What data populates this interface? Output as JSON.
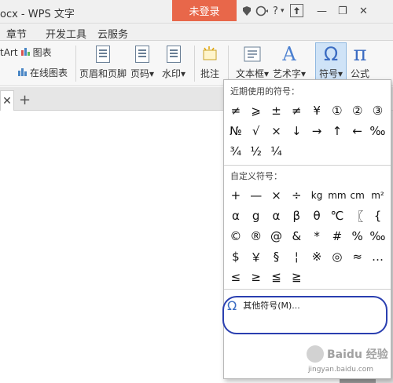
{
  "titlebar": {
    "doc_title": "ocx - WPS 文字",
    "login_button": "未登录",
    "help_icon": "?",
    "help_chevron": "▾",
    "minimize": "—",
    "restore": "❐",
    "close": "✕"
  },
  "menubar": {
    "items": [
      "章节",
      "开发工具",
      "云服务"
    ]
  },
  "ribbon": {
    "smartart": "tArt",
    "chart": "图表",
    "online_chart": "在线图表",
    "header_footer": "页眉和页脚",
    "page_number": "页码",
    "watermark": "水印",
    "annotation": "批注",
    "textbox": "文本框",
    "art_text": "艺术字",
    "symbol": "符号",
    "formula": "公式",
    "symbol_glyph": "Ω",
    "formula_glyph": "π",
    "art_glyph": "A",
    "dropdown_arrow": "▾"
  },
  "tabs": {
    "close": "✕",
    "add": "+"
  },
  "symbol_panel": {
    "recent_label": "近期使用的符号：",
    "custom_label": "自定义符号：",
    "recent_symbols": [
      "≠",
      "⩾",
      "±",
      "≠",
      "¥",
      "①",
      "②",
      "③",
      "№",
      "√",
      "×",
      "↓",
      "→",
      "↑",
      "←",
      "‰",
      "¾",
      "½",
      "¼"
    ],
    "custom_symbols": [
      "+",
      "—",
      "×",
      "÷",
      "kg",
      "mm",
      "cm",
      "m²",
      "α",
      "g",
      "α",
      "β",
      "θ",
      "℃",
      "〖",
      "{",
      "©",
      "®",
      "@",
      "&",
      "*",
      "#",
      "%",
      "‰",
      "$",
      "￥",
      "§",
      "¦",
      "※",
      "◎",
      "≈",
      "…",
      "≤",
      "≥",
      "≦",
      "≧"
    ],
    "more_icon": "Ω",
    "more_label": "其他符号(M)..."
  },
  "watermark": {
    "brand": "Baidu 经验",
    "url": "jingyan.baidu.com"
  }
}
